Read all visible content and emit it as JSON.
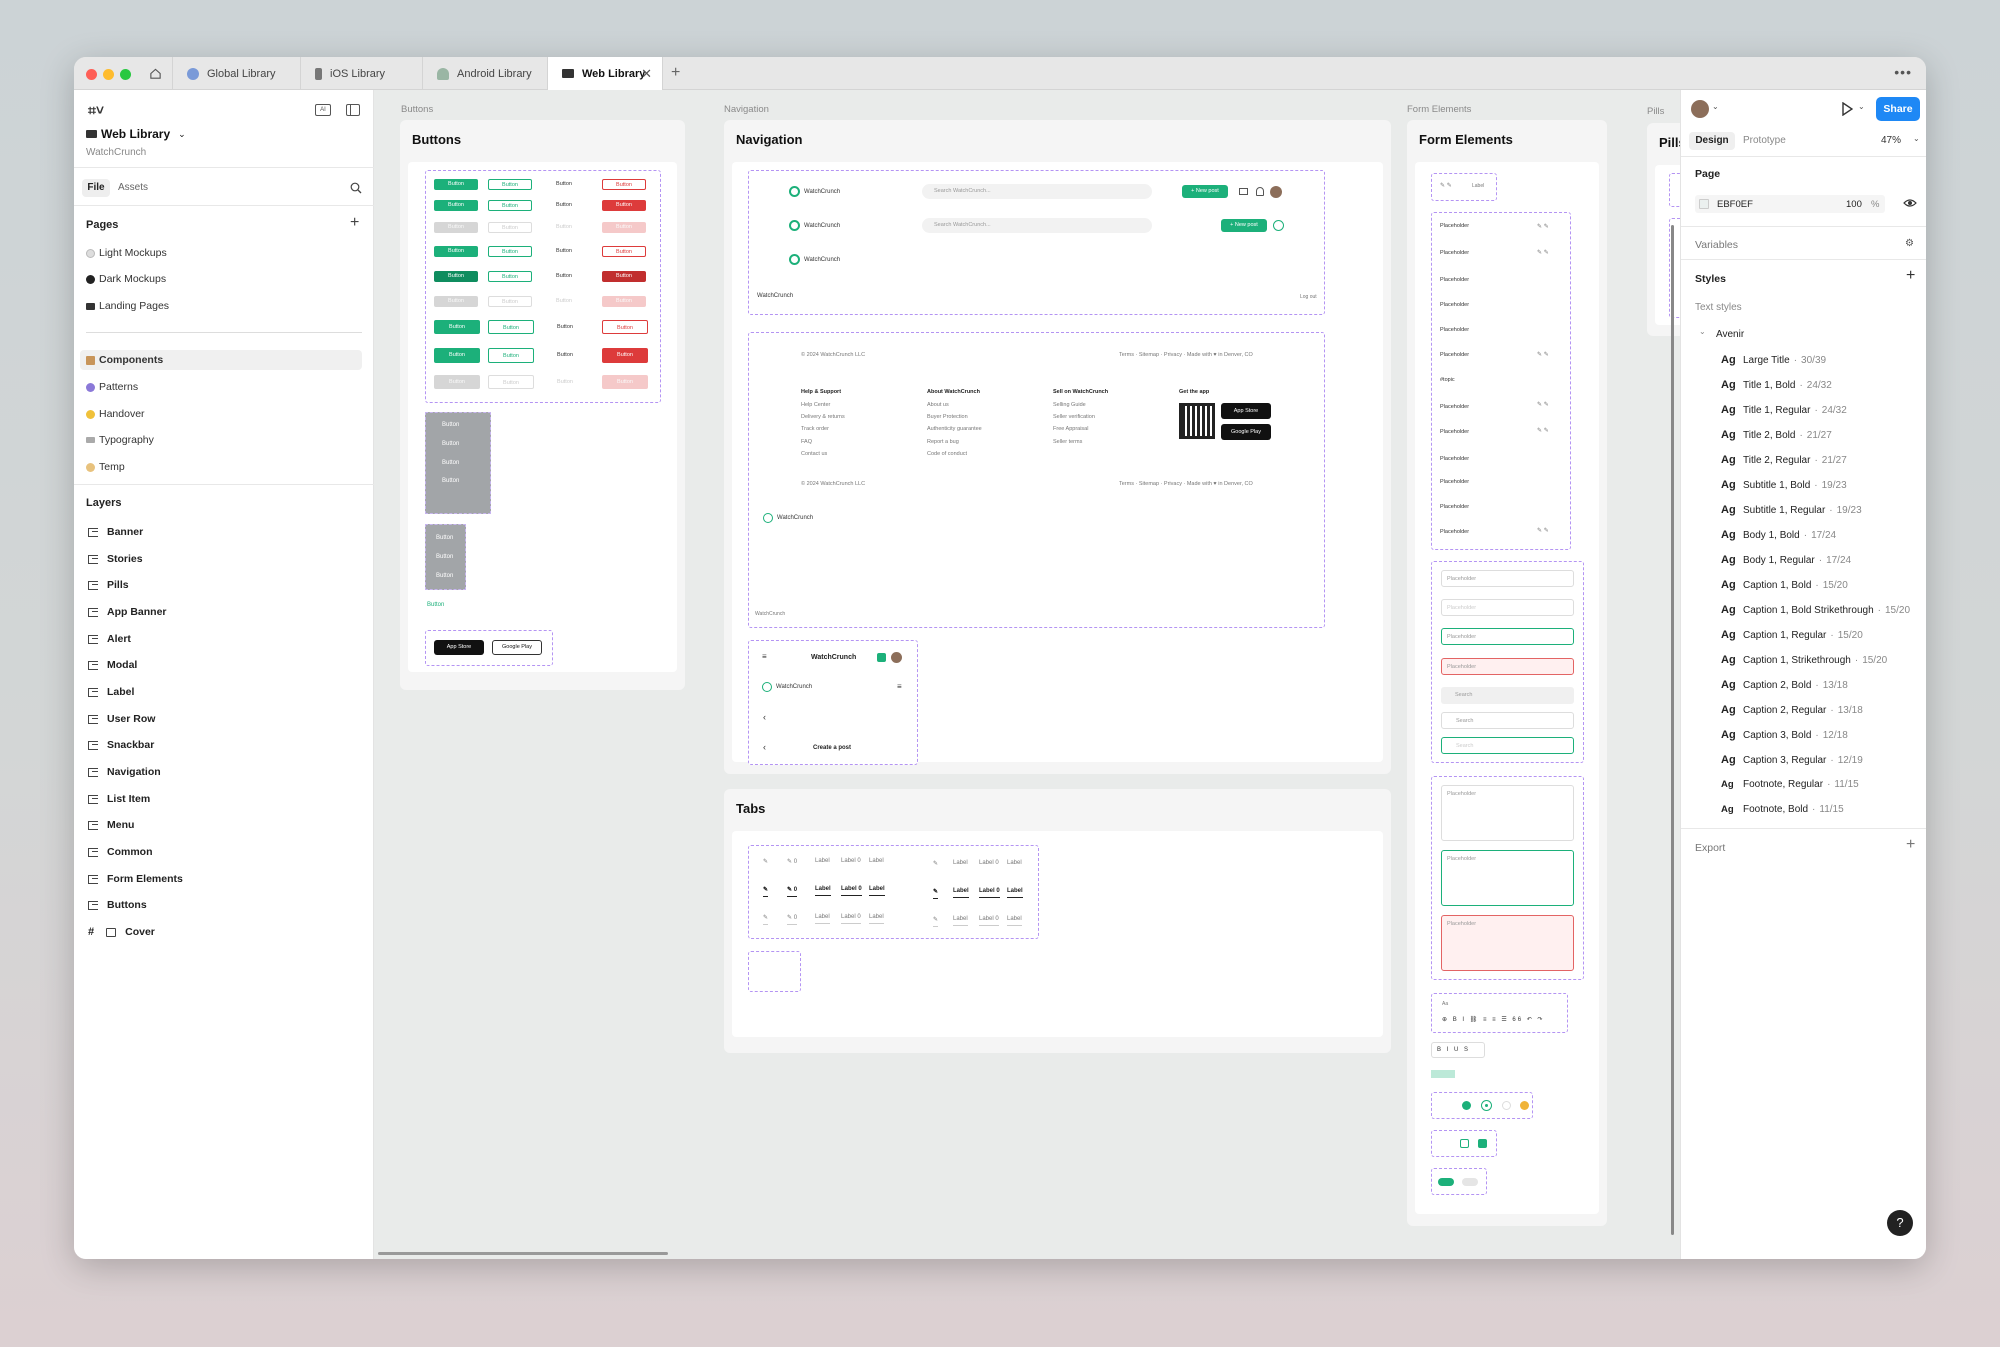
{
  "tabs": [
    {
      "label": "Global Library"
    },
    {
      "label": "iOS Library"
    },
    {
      "label": "Android Library"
    },
    {
      "label": "Web Library"
    }
  ],
  "file": {
    "name": "Web Library",
    "team": "WatchCrunch"
  },
  "left_tabs": {
    "file": "File",
    "assets": "Assets"
  },
  "pages": {
    "title": "Pages",
    "items": [
      {
        "label": "Light Mockups"
      },
      {
        "label": "Dark Mockups"
      },
      {
        "label": "Landing Pages"
      },
      {
        "label": "Components"
      },
      {
        "label": "Patterns"
      },
      {
        "label": "Handover"
      },
      {
        "label": "Typography"
      },
      {
        "label": "Temp"
      }
    ]
  },
  "layers": {
    "title": "Layers",
    "items": [
      {
        "label": "Banner"
      },
      {
        "label": "Stories"
      },
      {
        "label": "Pills"
      },
      {
        "label": "App Banner"
      },
      {
        "label": "Alert"
      },
      {
        "label": "Modal"
      },
      {
        "label": "Label"
      },
      {
        "label": "User Row"
      },
      {
        "label": "Snackbar"
      },
      {
        "label": "Navigation"
      },
      {
        "label": "List Item"
      },
      {
        "label": "Menu"
      },
      {
        "label": "Common"
      },
      {
        "label": "Form Elements"
      },
      {
        "label": "Buttons"
      },
      {
        "label": "Cover"
      }
    ]
  },
  "canvas": {
    "frame_labels": {
      "buttons": "Buttons",
      "navigation": "Navigation",
      "form": "Form Elements",
      "pills": "Pills"
    },
    "frames": {
      "buttons": "Buttons",
      "navigation": "Navigation",
      "tabs": "Tabs",
      "form": "Form Elements",
      "pills": "Pills"
    },
    "button_label": "Button",
    "brand": "WatchCrunch",
    "search_placeholder": "Search WatchCrunch...",
    "new_post": "+ New post",
    "log_out": "Log out",
    "create_post": "Create a post",
    "copyright": "© 2024 WatchCrunch LLC",
    "footer_links": "Terms · Sitemap · Privacy · Made with ♥ in Denver, CO",
    "footer_cols": [
      {
        "title": "Help & Support",
        "items": [
          "Help Center",
          "Delivery & returns",
          "Track order",
          "FAQ",
          "Contact us"
        ]
      },
      {
        "title": "About WatchCrunch",
        "items": [
          "About us",
          "Buyer Protection",
          "Authenticity guarantee",
          "Report a bug",
          "Code of conduct"
        ]
      },
      {
        "title": "Sell on WatchCrunch",
        "items": [
          "Selling Guide",
          "Seller verification",
          "Free Appraisal",
          "Seller terms"
        ]
      },
      {
        "title": "Get the app",
        "items": []
      }
    ],
    "app_store": "App Store",
    "google_play": "Google Play",
    "label": "Label",
    "label0": "Label 0",
    "placeholder": "Placeholder",
    "search": "Search",
    "hash_topic": "#topic",
    "aa": "Aa"
  },
  "right": {
    "tabs": {
      "design": "Design",
      "prototype": "Prototype"
    },
    "zoom": "47%",
    "share": "Share",
    "page_section": "Page",
    "page_color": "EBF0EF",
    "page_opacity": "100",
    "percent": "%",
    "variables": "Variables",
    "styles": "Styles",
    "text_styles": "Text styles",
    "font_group": "Avenir",
    "text_style_list": [
      {
        "name": "Large Title",
        "size": "30/39"
      },
      {
        "name": "Title 1, Bold",
        "size": "24/32"
      },
      {
        "name": "Title 1, Regular",
        "size": "24/32"
      },
      {
        "name": "Title 2, Bold",
        "size": "21/27"
      },
      {
        "name": "Title 2, Regular",
        "size": "21/27"
      },
      {
        "name": "Subtitle 1, Bold",
        "size": "19/23"
      },
      {
        "name": "Subtitle 1, Regular",
        "size": "19/23"
      },
      {
        "name": "Body 1, Bold",
        "size": "17/24"
      },
      {
        "name": "Body 1, Regular",
        "size": "17/24"
      },
      {
        "name": "Caption 1, Bold",
        "size": "15/20"
      },
      {
        "name": "Caption 1, Bold Strikethrough",
        "size": "15/20"
      },
      {
        "name": "Caption 1, Regular",
        "size": "15/20"
      },
      {
        "name": "Caption 1, Strikethrough",
        "size": "15/20"
      },
      {
        "name": "Caption 2, Bold",
        "size": "13/18"
      },
      {
        "name": "Caption 2, Regular",
        "size": "13/18"
      },
      {
        "name": "Caption 3, Bold",
        "size": "12/18"
      },
      {
        "name": "Caption 3, Regular",
        "size": "12/19"
      },
      {
        "name": "Footnote, Regular",
        "size": "11/15"
      },
      {
        "name": "Footnote, Bold",
        "size": "11/15"
      }
    ],
    "export": "Export",
    "ag": "Ag",
    "dot": "·"
  },
  "help": "?",
  "colors": {
    "accent": "#1e88f5",
    "brand_green": "#1cb07a",
    "danger": "#dd3b3b",
    "selection": "#b494f3"
  }
}
